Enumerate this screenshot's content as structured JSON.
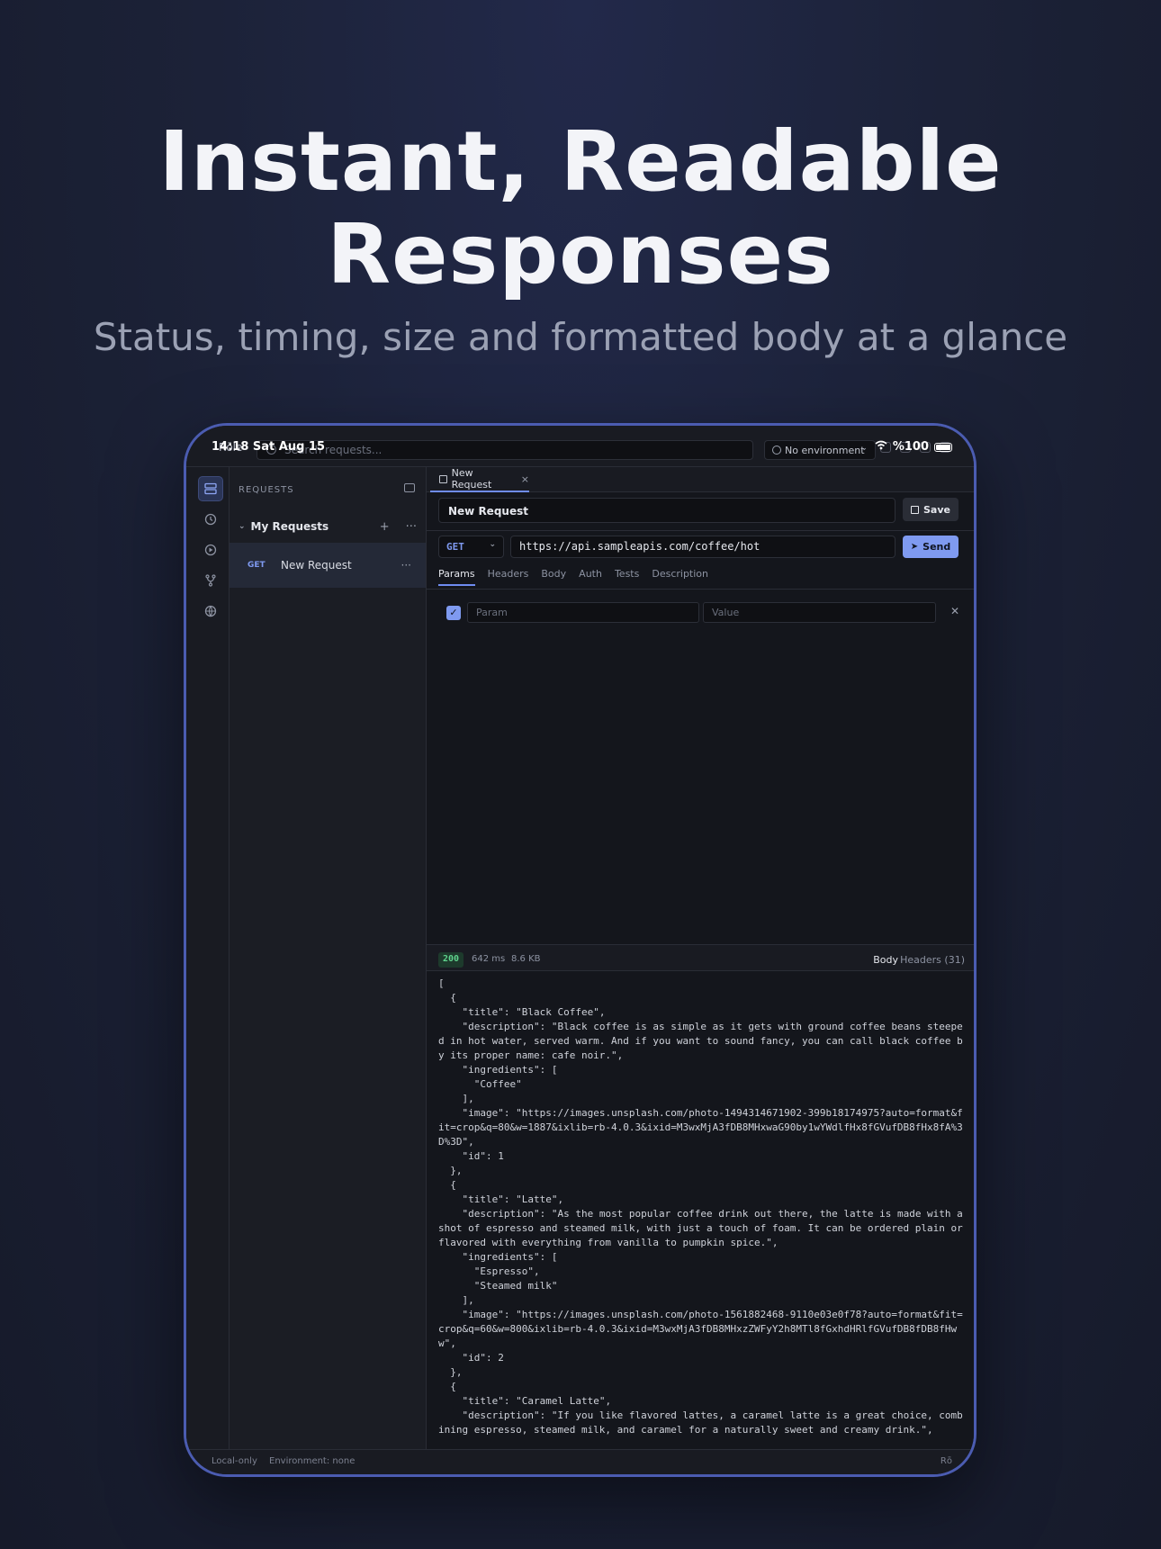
{
  "hero": {
    "title_line1": "Instant, Readable",
    "title_line2": "Responses",
    "subtitle": "Status, timing, size and formatted body at a glance"
  },
  "status_bar": {
    "time": "14:18  Sat Aug 15",
    "battery": "%100"
  },
  "topbar": {
    "app_name": "Rōle",
    "search_placeholder": "Search requests...",
    "environment": "No environment"
  },
  "rail": {
    "items": [
      {
        "icon": "requests-icon",
        "active": true
      },
      {
        "icon": "history-icon",
        "active": false
      },
      {
        "icon": "runner-icon",
        "active": false
      },
      {
        "icon": "git-branch-icon",
        "active": false
      },
      {
        "icon": "globe-icon",
        "active": false
      }
    ]
  },
  "sidebar": {
    "header": "REQUESTS",
    "collection": {
      "name": "My Requests",
      "add": "+",
      "more": "···"
    },
    "requests": [
      {
        "method": "GET",
        "name": "New Request",
        "more": "···"
      }
    ]
  },
  "tab": {
    "label": "New Request",
    "close": "×"
  },
  "request": {
    "name": "New Request",
    "save_label": "Save",
    "method": "GET",
    "url": "https://api.sampleapis.com/coffee/hot",
    "send_label": "Send",
    "tabs": [
      "Params",
      "Headers",
      "Body",
      "Auth",
      "Tests",
      "Description"
    ],
    "active_tab": "Params",
    "params": [
      {
        "enabled": true,
        "key_placeholder": "Param",
        "value_placeholder": "Value"
      }
    ]
  },
  "response": {
    "status": "200",
    "time": "642 ms",
    "size": "8.6 KB",
    "tab_body": "Body",
    "tab_headers": "Headers (31)",
    "body": "[\n  {\n    \"title\": \"Black Coffee\",\n    \"description\": \"Black coffee is as simple as it gets with ground coffee beans steeped in hot water, served warm. And if you want to sound fancy, you can call black coffee by its proper name: cafe noir.\",\n    \"ingredients\": [\n      \"Coffee\"\n    ],\n    \"image\": \"https://images.unsplash.com/photo-1494314671902-399b18174975?auto=format&fit=crop&q=80&w=1887&ixlib=rb-4.0.3&ixid=M3wxMjA3fDB8MHxwaG90by1wYWdlfHx8fGVufDB8fHx8fA%3D%3D\",\n    \"id\": 1\n  },\n  {\n    \"title\": \"Latte\",\n    \"description\": \"As the most popular coffee drink out there, the latte is made with a shot of espresso and steamed milk, with just a touch of foam. It can be ordered plain or flavored with everything from vanilla to pumpkin spice.\",\n    \"ingredients\": [\n      \"Espresso\",\n      \"Steamed milk\"\n    ],\n    \"image\": \"https://images.unsplash.com/photo-1561882468-9110e03e0f78?auto=format&fit=crop&q=60&w=800&ixlib=rb-4.0.3&ixid=M3wxMjA3fDB8MHxzZWFyY2h8MTl8fGxhdHRlfGVufDB8fDB8fHww\",\n    \"id\": 2\n  },\n  {\n    \"title\": \"Caramel Latte\",\n    \"description\": \"If you like flavored lattes, a caramel latte is a great choice, combining espresso, steamed milk, and caramel for a naturally sweet and creamy drink.\","
  },
  "footer": {
    "storage": "Local-only",
    "environment": "Environment: none",
    "brand": "Rō"
  }
}
